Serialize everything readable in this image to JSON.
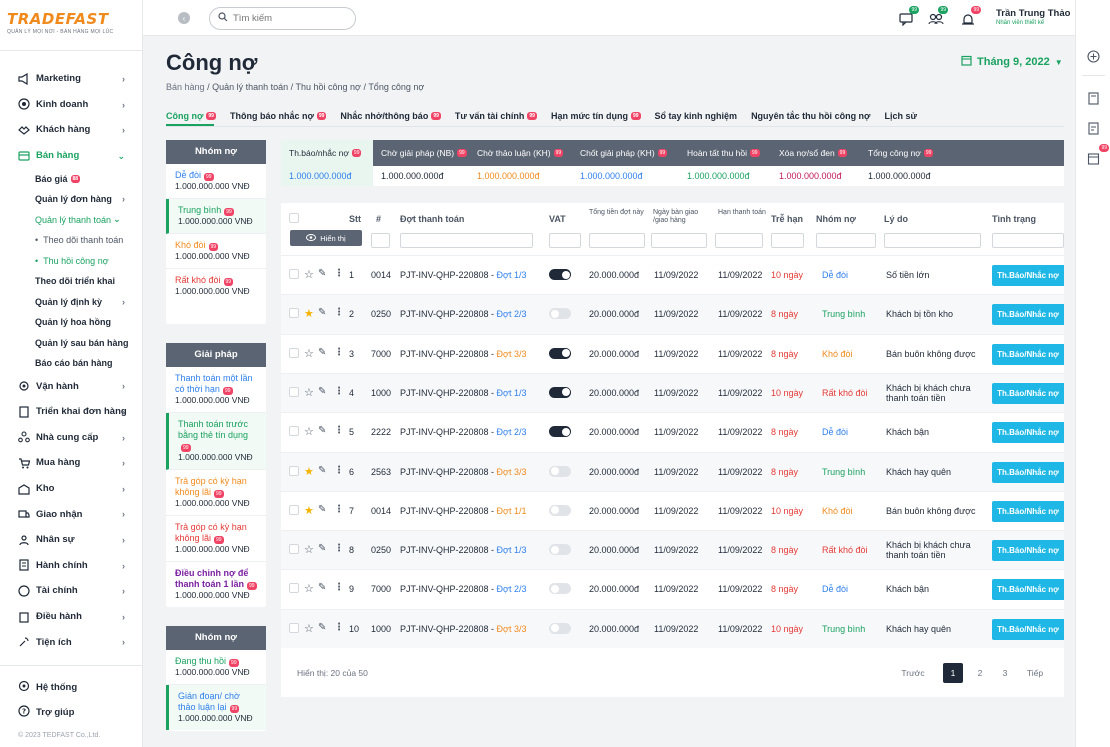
{
  "logo": {
    "text": "TRADEFAST",
    "tagline": "QUẢN LÝ MỌI NƠI - BÁN HÀNG MỌI LÚC"
  },
  "nav": [
    {
      "label": "Marketing",
      "icon": "megaphone-icon"
    },
    {
      "label": "Kinh doanh",
      "icon": "target-icon"
    },
    {
      "label": "Khách hàng",
      "icon": "handshake-icon"
    },
    {
      "label": "Bán hàng",
      "icon": "cart-icon"
    }
  ],
  "nav_sub": {
    "bao_gia": "Báo giá",
    "bao_gia_badge": "88",
    "don_hang": "Quản lý đơn hàng",
    "thanh_toan": "Quản lý thanh toán",
    "theo_doi_tt": "Theo dõi thanh toán",
    "thu_hoi": "Thu hồi công nợ",
    "trien_khai": "Theo dõi triển khai",
    "dinh_ky": "Quản lý định kỳ",
    "hoa_hong": "Quản lý hoa hồng",
    "sau_ban": "Quản lý sau bán hàng",
    "bao_cao": "Báo cáo bán hàng"
  },
  "nav2": [
    {
      "label": "Vận hành"
    },
    {
      "label": "Triển khai đơn hàng"
    },
    {
      "label": "Nhà cung cấp"
    },
    {
      "label": "Mua hàng"
    },
    {
      "label": "Kho"
    },
    {
      "label": "Giao nhận"
    },
    {
      "label": "Nhân sự"
    },
    {
      "label": "Hành chính"
    },
    {
      "label": "Tài chính"
    },
    {
      "label": "Điều hành"
    },
    {
      "label": "Tiện ích"
    }
  ],
  "bottom": {
    "system": "Hệ thống",
    "help": "Trợ giúp",
    "copyright": "© 2023 TEDFAST Co.,Ltd."
  },
  "topbar": {
    "search_placeholder": "Tìm kiếm",
    "badge1": "99",
    "badge2": "99",
    "badge3": "99",
    "user_name": "Trần Trung Thảo",
    "user_role": "Nhân viên thiết kế"
  },
  "rightbar": {
    "badge": "99"
  },
  "page": {
    "title": "Công nợ",
    "month": "Tháng 9, 2022"
  },
  "breadcrumb": [
    "Bán hàng",
    "Quản lý thanh toán",
    "Thu hồi công nợ",
    "Tổng công nợ"
  ],
  "tabs": [
    {
      "label": "Công nợ",
      "badge": "99"
    },
    {
      "label": "Thông báo nhắc nợ",
      "badge": "99"
    },
    {
      "label": "Nhắc nhở/thông báo",
      "badge": "99"
    },
    {
      "label": "Tư vấn tài chính",
      "badge": "99"
    },
    {
      "label": "Hạn mức tín dụng",
      "badge": "99"
    },
    {
      "label": "Sổ tay kinh nghiệm",
      "badge": ""
    },
    {
      "label": "Nguyên tắc thu hồi công nợ",
      "badge": ""
    },
    {
      "label": "Lịch sử",
      "badge": ""
    }
  ],
  "group1": {
    "title": "Nhóm nợ",
    "items": [
      {
        "label": "Dễ đòi",
        "badge": "99",
        "value": "1.000.000.000 VNĐ",
        "color": "#2f80ed"
      },
      {
        "label": "Trung bình",
        "badge": "99",
        "value": "1.000.000.000 VNĐ",
        "color": "#1aa260"
      },
      {
        "label": "Khó đòi",
        "badge": "99",
        "value": "1.000.000.000 VNĐ",
        "color": "#f08a1c"
      },
      {
        "label": "Rất khó đòi",
        "badge": "99",
        "value": "1.000.000.000 VNĐ",
        "color": "#e53935"
      }
    ]
  },
  "group2": {
    "title": "Giải pháp",
    "items": [
      {
        "label": "Thanh toán một lần có thời hạn",
        "badge": "99",
        "value": "1.000.000.000 VNĐ",
        "color": "#2f80ed"
      },
      {
        "label": "Thanh toán trước bằng thẻ tín dụng",
        "badge": "99",
        "value": "1.000.000.000 VNĐ",
        "color": "#1aa260"
      },
      {
        "label": "Trả góp có kỳ hạn không lãi",
        "badge": "99",
        "value": "1.000.000.000 VNĐ",
        "color": "#f08a1c"
      },
      {
        "label": "Trả góp có kỳ hạn không lãi",
        "badge": "99",
        "value": "1.000.000.000 VNĐ",
        "color": "#e53935"
      },
      {
        "label": "Điều chỉnh nợ để thanh toán 1 lần",
        "badge": "99",
        "value": "1.000.000.000 VNĐ",
        "color": "#7b1fa2"
      }
    ]
  },
  "group3": {
    "title": "Nhóm nợ",
    "items": [
      {
        "label": "Đang thu hồi",
        "badge": "99",
        "value": "1.000.000.000 VNĐ",
        "color": "#1aa260"
      },
      {
        "label": "Gián đoạn/ chờ thảo luận lại",
        "badge": "99",
        "value": "1.000.000.000 VNĐ",
        "color": "#2f80ed"
      }
    ]
  },
  "summary": {
    "headers": [
      {
        "label": "Th.báo/nhắc nợ",
        "badge": "99"
      },
      {
        "label": "Chờ giải pháp (NB)",
        "badge": "99"
      },
      {
        "label": "Chờ thảo luận (KH)",
        "badge": "99"
      },
      {
        "label": "Chốt giải pháp (KH)",
        "badge": "99"
      },
      {
        "label": "Hoàn tất thu hồi",
        "badge": "99"
      },
      {
        "label": "Xóa nợ/sổ đen",
        "badge": "99"
      },
      {
        "label": "Tổng công nợ",
        "badge": "99"
      }
    ],
    "values": [
      {
        "v": "1.000.000.000đ",
        "color": "#2f80ed"
      },
      {
        "v": "1.000.000.000đ",
        "color": "#1f2937"
      },
      {
        "v": "1.000.000.000đ",
        "color": "#f08a1c"
      },
      {
        "v": "1.000.000.000đ",
        "color": "#2f80ed"
      },
      {
        "v": "1.000.000.000đ",
        "color": "#1aa260"
      },
      {
        "v": "1.000.000.000đ",
        "color": "#c2185b"
      },
      {
        "v": "1.000.000.000đ",
        "color": "#1f2937"
      }
    ]
  },
  "table": {
    "headers": {
      "stt": "Stt",
      "num": "#",
      "dot": "Đợt thanh toán",
      "vat": "VAT",
      "tong": "Tổng tiền đợt này",
      "ngay": "Ngày bàn giao /giao hàng",
      "han": "Hạn thanh toán",
      "tre": "Trễ hạn",
      "nhom": "Nhóm nợ",
      "lydo": "Lý do",
      "tinhtrang": "Tình trạng"
    },
    "show_label": "Hiển thị",
    "action_label": "Th.Báo/Nhắc nợ",
    "rows": [
      {
        "stt": "1",
        "num": "0014",
        "code": "PJT-INV-QHP-220808 - ",
        "dot": "Đợt 1/3",
        "dot_color": "#2f80ed",
        "vat": true,
        "star": false,
        "tong": "20.000.000đ",
        "ngay": "11/09/2022",
        "han": "11/09/2022",
        "tre": "10 ngày",
        "nhom": "Dễ đòi",
        "nhom_color": "#2f80ed",
        "lydo": "Số tiền lớn"
      },
      {
        "stt": "2",
        "num": "0250",
        "code": "PJT-INV-QHP-220808 - ",
        "dot": "Đợt 2/3",
        "dot_color": "#2f80ed",
        "vat": false,
        "star": true,
        "tong": "20.000.000đ",
        "ngay": "11/09/2022",
        "han": "11/09/2022",
        "tre": "8 ngày",
        "nhom": "Trung bình",
        "nhom_color": "#1aa260",
        "lydo": "Khách bị tồn kho"
      },
      {
        "stt": "3",
        "num": "7000",
        "code": "PJT-INV-QHP-220808 - ",
        "dot": "Đợt 3/3",
        "dot_color": "#f08a1c",
        "vat": true,
        "star": false,
        "tong": "20.000.000đ",
        "ngay": "11/09/2022",
        "han": "11/09/2022",
        "tre": "8 ngày",
        "nhom": "Khó đòi",
        "nhom_color": "#f08a1c",
        "lydo": "Bán buôn không được"
      },
      {
        "stt": "4",
        "num": "1000",
        "code": "PJT-INV-QHP-220808 - ",
        "dot": "Đợt 1/3",
        "dot_color": "#2f80ed",
        "vat": true,
        "star": false,
        "tong": "20.000.000đ",
        "ngay": "11/09/2022",
        "han": "11/09/2022",
        "tre": "10 ngày",
        "nhom": "Rất khó đòi",
        "nhom_color": "#e53935",
        "lydo": "Khách bị khách chưa thanh toán tiền"
      },
      {
        "stt": "5",
        "num": "2222",
        "code": "PJT-INV-QHP-220808 - ",
        "dot": "Đợt 2/3",
        "dot_color": "#2f80ed",
        "vat": true,
        "star": false,
        "tong": "20.000.000đ",
        "ngay": "11/09/2022",
        "han": "11/09/2022",
        "tre": "8 ngày",
        "nhom": "Dễ đòi",
        "nhom_color": "#2f80ed",
        "lydo": "Khách bận"
      },
      {
        "stt": "6",
        "num": "2563",
        "code": "PJT-INV-QHP-220808 - ",
        "dot": "Đợt 3/3",
        "dot_color": "#f08a1c",
        "vat": false,
        "star": true,
        "tong": "20.000.000đ",
        "ngay": "11/09/2022",
        "han": "11/09/2022",
        "tre": "8 ngày",
        "nhom": "Trung bình",
        "nhom_color": "#1aa260",
        "lydo": "Khách hay quên"
      },
      {
        "stt": "7",
        "num": "0014",
        "code": "PJT-INV-QHP-220808 - ",
        "dot": "Đợt 1/1",
        "dot_color": "#f08a1c",
        "vat": false,
        "star": true,
        "tong": "20.000.000đ",
        "ngay": "11/09/2022",
        "han": "11/09/2022",
        "tre": "10 ngày",
        "nhom": "Khó đòi",
        "nhom_color": "#f08a1c",
        "lydo": "Bán buôn không được"
      },
      {
        "stt": "8",
        "num": "0250",
        "code": "PJT-INV-QHP-220808 - ",
        "dot": "Đợt 1/3",
        "dot_color": "#2f80ed",
        "vat": false,
        "star": false,
        "tong": "20.000.000đ",
        "ngay": "11/09/2022",
        "han": "11/09/2022",
        "tre": "8 ngày",
        "nhom": "Rất khó đòi",
        "nhom_color": "#e53935",
        "lydo": "Khách bị khách chưa thanh toán tiền"
      },
      {
        "stt": "9",
        "num": "7000",
        "code": "PJT-INV-QHP-220808 - ",
        "dot": "Đợt 2/3",
        "dot_color": "#2f80ed",
        "vat": false,
        "star": false,
        "tong": "20.000.000đ",
        "ngay": "11/09/2022",
        "han": "11/09/2022",
        "tre": "8 ngày",
        "nhom": "Dễ đòi",
        "nhom_color": "#2f80ed",
        "lydo": "Khách bận"
      },
      {
        "stt": "10",
        "num": "1000",
        "code": "PJT-INV-QHP-220808 - ",
        "dot": "Đợt 3/3",
        "dot_color": "#f08a1c",
        "vat": false,
        "star": false,
        "tong": "20.000.000đ",
        "ngay": "11/09/2022",
        "han": "11/09/2022",
        "tre": "10 ngày",
        "nhom": "Trung bình",
        "nhom_color": "#1aa260",
        "lydo": "Khách hay quên"
      }
    ],
    "footer": "Hiển thị: 20 của 50",
    "pager": {
      "prev": "Trước",
      "p1": "1",
      "p2": "2",
      "p3": "3",
      "next": "Tiếp"
    }
  }
}
